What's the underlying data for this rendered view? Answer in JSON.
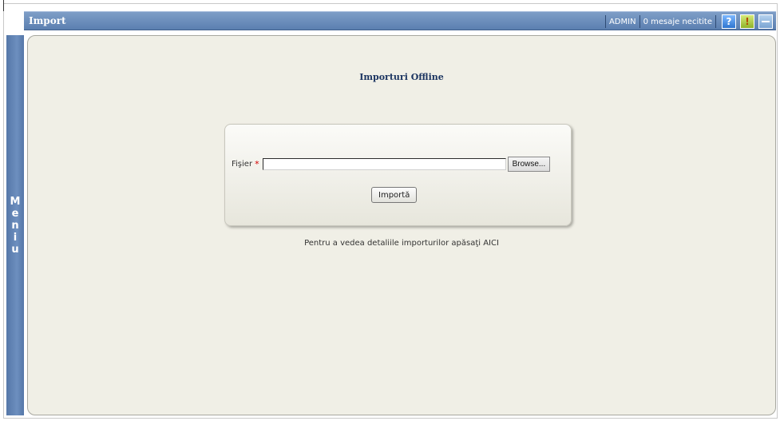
{
  "header": {
    "title": "Import",
    "user": "ADMIN",
    "messages": "0 mesaje necitite",
    "help_icon": "?",
    "alert_icon": "!"
  },
  "side_menu": {
    "letters": [
      "M",
      "e",
      "n",
      "i",
      "u"
    ]
  },
  "main": {
    "title": "Importuri Offline",
    "form": {
      "file_label": "Fişier",
      "required_mark": "*",
      "file_value": "",
      "browse_label": "Browse...",
      "import_label": "Importă"
    },
    "info_text": "Pentru a vedea detaliile importurilor apăsaţi AICI"
  }
}
